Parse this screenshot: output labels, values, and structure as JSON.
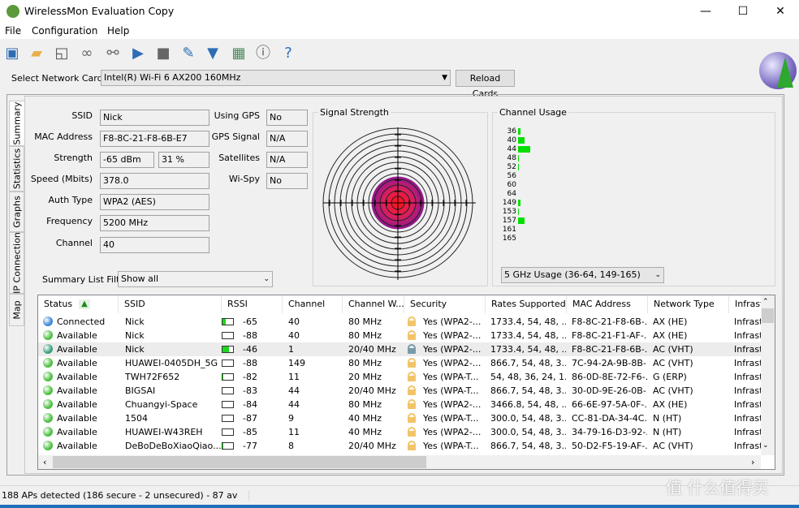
{
  "window": {
    "title": "WirelessMon Evaluation Copy",
    "min": "—",
    "max": "☐",
    "close": "✕"
  },
  "menu": [
    "File",
    "Configuration",
    "Help"
  ],
  "toolbar": [
    "save-icon",
    "open-folder-icon",
    "export-icon",
    "connect-link-icon",
    "disconnect-link-icon",
    "play-icon",
    "stop-icon",
    "clipboard-edit-icon",
    "antenna-icon",
    "map-icon",
    "alert-icon",
    "help-globe-icon"
  ],
  "network_card": {
    "label": "Select Network Card",
    "value": "Intel(R) Wi-Fi 6 AX200 160MHz",
    "reload": "Reload Cards"
  },
  "tabs": [
    "Summary",
    "Statistics",
    "Graphs",
    "IP Connection",
    "Map"
  ],
  "summary": {
    "ssid_label": "SSID",
    "ssid": "Nick",
    "mac_label": "MAC Address",
    "mac": "F8-8C-21-F8-6B-E7",
    "strength_label": "Strength",
    "strength_dbm": "-65 dBm",
    "strength_pct": "31 %",
    "speed_label": "Speed (Mbits)",
    "speed": "378.0",
    "auth_label": "Auth Type",
    "auth": "WPA2 (AES)",
    "freq_label": "Frequency",
    "freq": "5200 MHz",
    "channel_label": "Channel",
    "channel": "40",
    "gps_label": "Using GPS",
    "gps": "No",
    "gps_signal_label": "GPS Signal",
    "gps_signal": "N/A",
    "sat_label": "Satellites",
    "sat": "N/A",
    "wispy_label": "Wi-Spy",
    "wispy": "No",
    "filter_label": "Summary List Filter:",
    "filter": "Show all"
  },
  "signal": {
    "title": "Signal Strength",
    "strength_pct": 31
  },
  "channel_usage": {
    "title": "Channel Usage",
    "select": "5 GHz Usage (36-64, 149-165)",
    "channels": [
      {
        "ch": "36",
        "v": 1
      },
      {
        "ch": "40",
        "v": 3
      },
      {
        "ch": "44",
        "v": 6
      },
      {
        "ch": "48",
        "v": 0.3
      },
      {
        "ch": "52",
        "v": 0.3
      },
      {
        "ch": "56",
        "v": 0
      },
      {
        "ch": "60",
        "v": 0
      },
      {
        "ch": "64",
        "v": 0
      },
      {
        "ch": "149",
        "v": 1
      },
      {
        "ch": "153",
        "v": 0.3
      },
      {
        "ch": "157",
        "v": 3
      },
      {
        "ch": "161",
        "v": 0
      },
      {
        "ch": "165",
        "v": 0
      }
    ]
  },
  "table": {
    "headers": [
      "Status",
      "SSID",
      "RSSI",
      "Channel",
      "Channel W...",
      "Security",
      "Rates Supported",
      "MAC Address",
      "Network Type",
      "Infrastr"
    ],
    "rows": [
      {
        "status": "Connected",
        "ssid": "Nick",
        "rssi": "-65",
        "bar": 0.3,
        "ch": "40",
        "w": "80 MHz",
        "sec": "Yes (WPA2-...",
        "rates": "1733.4, 54, 48, ...",
        "mac": "F8-8C-21-F8-6B-...",
        "type": "AX (HE)",
        "infra": "Infrastr"
      },
      {
        "status": "Available",
        "ssid": "Nick",
        "rssi": "-88",
        "bar": 0,
        "ch": "40",
        "w": "80 MHz",
        "sec": "Yes (WPA2-...",
        "rates": "1733.4, 54, 48, ...",
        "mac": "F8-8C-21-F1-AF-...",
        "type": "AX (HE)",
        "infra": "Infrastr"
      },
      {
        "status": "Available",
        "ssid": "Nick",
        "rssi": "-46",
        "bar": 0.6,
        "ch": "1",
        "w": "20/40 MHz",
        "sec": "Yes (WPA2-...",
        "rates": "1733.4, 54, 48, ...",
        "mac": "F8-8C-21-F8-6B-...",
        "type": "AC (VHT)",
        "infra": "Infrastr"
      },
      {
        "status": "Available",
        "ssid": "HUAWEI-0405DH_5G",
        "rssi": "-88",
        "bar": 0,
        "ch": "149",
        "w": "80 MHz",
        "sec": "Yes (WPA2-...",
        "rates": "866.7, 54, 48, 3...",
        "mac": "7C-94-2A-9B-8B-...",
        "type": "AC (VHT)",
        "infra": "Infrastr"
      },
      {
        "status": "Available",
        "ssid": "TWH72F652",
        "rssi": "-82",
        "bar": 0.1,
        "ch": "11",
        "w": "20 MHz",
        "sec": "Yes (WPA-T...",
        "rates": "54, 48, 36, 24, 1...",
        "mac": "86-0D-8E-72-F6-...",
        "type": "G (ERP)",
        "infra": "Infrastr"
      },
      {
        "status": "Available",
        "ssid": "BIGSAI",
        "rssi": "-83",
        "bar": 0,
        "ch": "44",
        "w": "20/40 MHz",
        "sec": "Yes (WPA-T...",
        "rates": "866.7, 54, 48, 3...",
        "mac": "30-0D-9E-26-0B-...",
        "type": "AC (VHT)",
        "infra": "Infrastr"
      },
      {
        "status": "Available",
        "ssid": "Chuangyi-Space",
        "rssi": "-84",
        "bar": 0,
        "ch": "44",
        "w": "80 MHz",
        "sec": "Yes (WPA2-...",
        "rates": "3466.8, 54, 48, ...",
        "mac": "66-6E-97-5A-0F-...",
        "type": "AX (HE)",
        "infra": "Infrastr"
      },
      {
        "status": "Available",
        "ssid": "1504",
        "rssi": "-87",
        "bar": 0,
        "ch": "9",
        "w": "40 MHz",
        "sec": "Yes (WPA-T...",
        "rates": "300.0, 54, 48, 3...",
        "mac": "CC-81-DA-34-4C...",
        "type": "N (HT)",
        "infra": "Infrastr"
      },
      {
        "status": "Available",
        "ssid": "HUAWEI-W43REH",
        "rssi": "-85",
        "bar": 0,
        "ch": "11",
        "w": "40 MHz",
        "sec": "Yes (WPA2-...",
        "rates": "300.0, 54, 48, 3...",
        "mac": "34-79-16-D3-92-...",
        "type": "N (HT)",
        "infra": "Infrastr"
      },
      {
        "status": "Available",
        "ssid": "DeBoDeBoXiaoQiao...",
        "rssi": "-77",
        "bar": 0.1,
        "ch": "8",
        "w": "20/40 MHz",
        "sec": "Yes (WPA-T...",
        "rates": "866.7, 54, 48, 3...",
        "mac": "50-D2-F5-19-AF-...",
        "type": "AC (VHT)",
        "infra": "Infrastr"
      }
    ]
  },
  "statusbar": "188 APs detected (186 secure - 2 unsecured) - 87 av",
  "watermark": "值 什么值得买"
}
